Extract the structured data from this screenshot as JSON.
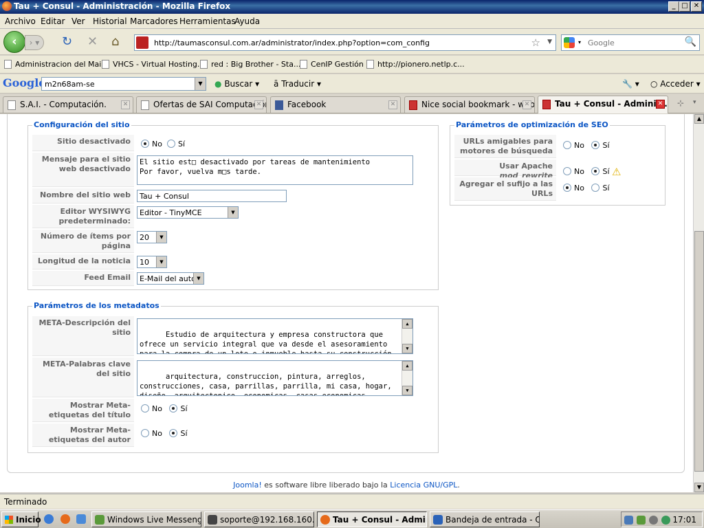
{
  "window": {
    "title": "Tau + Consul - Administración - Mozilla Firefox"
  },
  "menu": [
    "Archivo",
    "Editar",
    "Ver",
    "Historial",
    "Marcadores",
    "Herramientas",
    "Ayuda"
  ],
  "nav": {
    "url": "http://taumasconsul.com.ar/administrator/index.php?option=com_config",
    "search_placeholder": "Google"
  },
  "bookmarks": [
    "Administracion del Mai...",
    "VHCS - Virtual Hosting...",
    "red : Big Brother - Sta...",
    "CenIP Gestión",
    "http://pionero.netlp.c..."
  ],
  "google_toolbar": {
    "logo": "Google",
    "query": "m2n68am-se",
    "search_label": "Buscar",
    "translate_label": "Traducir",
    "signin_label": "Acceder"
  },
  "tabs": [
    {
      "label": "S.A.I. - Computación.",
      "active": false
    },
    {
      "label": "Ofertas de SAI Computación",
      "active": false
    },
    {
      "label": "Facebook",
      "active": false
    },
    {
      "label": "Nice social bookmark - web...",
      "active": false
    },
    {
      "label": "Tau + Consul - Adminis...",
      "active": true
    }
  ],
  "site_config": {
    "legend": "Configuración del sitio",
    "offline_label": "Sitio desactivado",
    "offline_no": "No",
    "offline_yes": "Sí",
    "offline_msg_label": "Mensaje para el sitio web desactivado",
    "offline_msg": "El sitio est□ desactivado por tareas de mantenimiento\nPor favor, vuelva m□s tarde.",
    "sitename_label": "Nombre del sitio web",
    "sitename": "Tau + Consul",
    "editor_label": "Editor WYSIWYG predeterminado:",
    "editor": "Editor - TinyMCE",
    "list_limit_label": "Número de ítems por página",
    "list_limit": "20",
    "feed_limit_label": "Longitud de la noticia",
    "feed_limit": "10",
    "feed_email_label": "Feed Email",
    "feed_email": "E-Mail del autor"
  },
  "metadata": {
    "legend": "Parámetros de los metadatos",
    "desc_label": "META-Descripción del sitio",
    "desc": "Estudio de arquitectura y empresa constructora que ofrece un servicio integral que va desde el asesoramiento para la compra de un lote o inmueble hasta su construcción, reforma o mantenimiento",
    "keys_label": "META-Palabras clave del sitio",
    "keys": "arquitectura, construccion, pintura, arreglos, construcciones, casa, parrillas, parrilla, mi casa, hogar, diseño, arquitectonico, economicas, casas economicas, materiales, materiales de construccion",
    "show_title_label": "Mostrar Meta-etiquetas del título",
    "show_author_label": "Mostrar Meta-etiquetas del autor",
    "no": "No",
    "yes": "Sí"
  },
  "seo": {
    "legend": "Parámetros de optimización de SEO",
    "sef_label": "URLs amigables para motores de búsqueda",
    "rewrite_label_a": "Usar Apache ",
    "rewrite_label_b": "mod_rewrite",
    "suffix_label": "Agregar el sufijo a las URLs",
    "no": "No",
    "yes": "Sí"
  },
  "footer": {
    "joomla": "Joomla!",
    "text": " es software libre liberado bajo la ",
    "license": "Licencia GNU/GPL",
    "end": "."
  },
  "status": "Terminado",
  "taskbar": {
    "start": "Inicio",
    "tasks": [
      "Windows Live Messenger",
      "soporte@192.168.160.9...",
      "Tau + Consul - Admini...",
      "Bandeja de entrada - Ou..."
    ],
    "clock": "17:01"
  }
}
